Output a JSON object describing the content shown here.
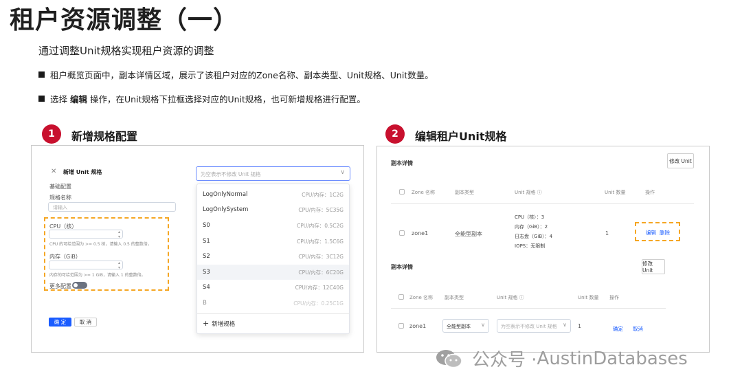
{
  "title": "租户资源调整（一）",
  "subtitle": "通过调整Unit规格实现租户资源的调整",
  "bullets": [
    {
      "text": "租户概览页面中，副本详情区域，展示了该租户对应的Zone名称、副本类型、Unit规格、Unit数量。"
    },
    {
      "prefix": "选择",
      "bold": "编辑",
      "suffix": "操作，在Unit规格下拉框选择对应的Unit规格，也可新增规格进行配置。"
    }
  ],
  "steps": [
    {
      "number": "1",
      "label": "新增规格配置"
    },
    {
      "number": "2",
      "label": "编辑租户Unit规格"
    }
  ],
  "left_panel": {
    "dialog_title": "新增 Unit 规格",
    "close_glyph": "✕",
    "section_basic": "基础配置",
    "spec_name_label": "规格名称",
    "spec_name_placeholder": "请输入",
    "cpu_label": "CPU（核）",
    "cpu_hint": "CPU 的可给范围为 >= 0.5 核，请输入 0.5 的整数倍。",
    "mem_label": "内存（GiB）",
    "mem_hint": "内存的可给范围为 >= 1 GiB，请输入 1 的整数倍。",
    "more_config": "更多配置",
    "confirm": "确 定",
    "cancel": "取 消",
    "select_placeholder": "为空表示不修改 Unit 规格",
    "options": [
      {
        "name": "LogOnlyNormal",
        "spec": "CPU/内存：1C2G"
      },
      {
        "name": "LogOnlySystem",
        "spec": "CPU/内存：5C35G"
      },
      {
        "name": "S0",
        "spec": "CPU/内存：0.5C2G"
      },
      {
        "name": "S1",
        "spec": "CPU/内存：1.5C6G"
      },
      {
        "name": "S2",
        "spec": "CPU/内存：3C12G"
      },
      {
        "name": "S3",
        "spec": "CPU/内存：6C20G"
      },
      {
        "name": "S4",
        "spec": "CPU/内存：12C40G"
      },
      {
        "name": "B",
        "spec": "CPU/内存：0.25C1G"
      }
    ],
    "add_spec": "新增规格"
  },
  "right_panel": {
    "section_title": "副本详情",
    "modify_unit": "修改 Unit",
    "columns": [
      "Zone 名称",
      "副本类型",
      "Unit 规格 ⓘ",
      "Unit 数量",
      "操作"
    ],
    "row": {
      "zone": "zone1",
      "replica_type": "全能型副本",
      "spec_cpu": "CPU（核）：3",
      "spec_mem": "内存（GiB）：2",
      "spec_log": "日志盘（GiB）：4",
      "spec_iops": "IOPS：无限制",
      "unit_count": "1",
      "edit": "编辑",
      "delete": "删除"
    },
    "edit_section_title": "副本详情",
    "edit_modify_unit": "修改 Unit",
    "edit_columns": [
      "Zone 名称",
      "副本类型",
      "Unit 规格 ⓘ",
      "Unit 数量",
      "操作"
    ],
    "edit_row": {
      "zone": "zone1",
      "replica_type": "全能型副本",
      "spec_placeholder": "为空表示不修改 Unit 规格",
      "unit_count": "1",
      "confirm": "确定",
      "cancel": "取消"
    }
  },
  "watermark": {
    "prefix": "公众号 · ",
    "name": "AustinDatabases"
  },
  "colors": {
    "step_red": "#c8102e",
    "dashed_orange": "#f5a623",
    "primary_blue": "#1a5cff"
  }
}
